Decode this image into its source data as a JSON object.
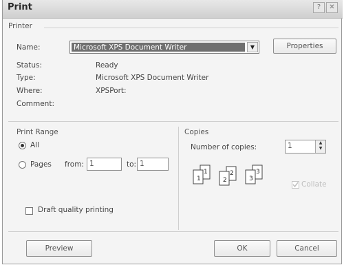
{
  "window": {
    "title": "Print",
    "help_glyph": "?",
    "close_glyph": "✕"
  },
  "printer": {
    "group_label": "Printer",
    "name_label": "Name:",
    "name_value": "Microsoft XPS Document Writer",
    "properties_label": "Properties",
    "status_label": "Status:",
    "status_value": "Ready",
    "type_label": "Type:",
    "type_value": "Microsoft XPS Document Writer",
    "where_label": "Where:",
    "where_value": "XPSPort:",
    "comment_label": "Comment:",
    "comment_value": ""
  },
  "print_range": {
    "group_label": "Print Range",
    "all_label": "All",
    "all_selected": true,
    "pages_label": "Pages",
    "from_label": "from:",
    "from_value": "1",
    "to_label": "to:",
    "to_value": "1"
  },
  "copies": {
    "group_label": "Copies",
    "number_label": "Number of copies:",
    "number_value": "1",
    "collate_label": "Collate",
    "collate_checked": true,
    "collate_enabled": false,
    "page_numbers": [
      "1",
      "1",
      "2",
      "2",
      "3",
      "3"
    ]
  },
  "draft": {
    "label": "Draft quality printing",
    "checked": false
  },
  "buttons": {
    "preview": "Preview",
    "ok": "OK",
    "cancel": "Cancel"
  }
}
